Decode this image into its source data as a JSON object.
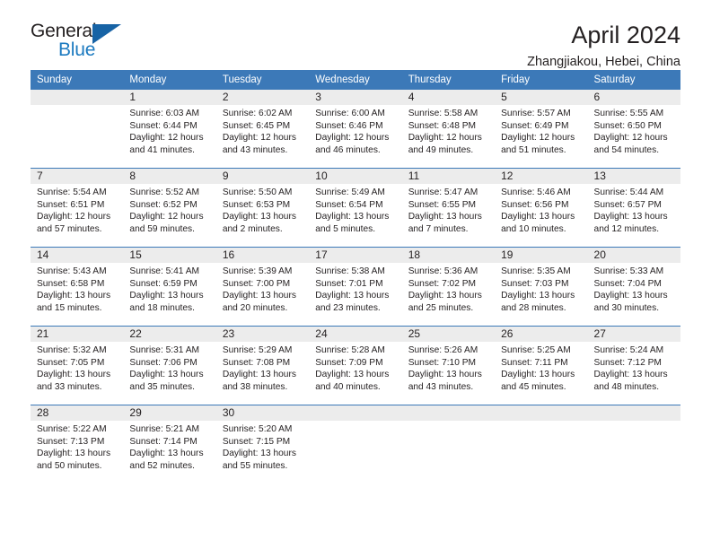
{
  "logo": {
    "primary_text": "General",
    "secondary_text": "Blue",
    "primary_color": "#231f20",
    "secondary_color": "#1c7ac0",
    "triangle_color": "#1763a5",
    "icon": "triangle-icon"
  },
  "header": {
    "title": "April 2024",
    "subtitle": "Zhangjiakou, Hebei, China"
  },
  "theme": {
    "header_row_bg": "#3c79b8",
    "header_row_text": "#ffffff",
    "day_number_bg": "#ececec",
    "grid_line": "#3c79b8",
    "body_text": "#231f20"
  },
  "calendar": {
    "weekday_headers": [
      "Sunday",
      "Monday",
      "Tuesday",
      "Wednesday",
      "Thursday",
      "Friday",
      "Saturday"
    ],
    "weeks": [
      [
        {
          "day": "",
          "sunrise": "",
          "sunset": "",
          "daylight_line1": "",
          "daylight_line2": ""
        },
        {
          "day": "1",
          "sunrise": "Sunrise: 6:03 AM",
          "sunset": "Sunset: 6:44 PM",
          "daylight_line1": "Daylight: 12 hours",
          "daylight_line2": "and 41 minutes."
        },
        {
          "day": "2",
          "sunrise": "Sunrise: 6:02 AM",
          "sunset": "Sunset: 6:45 PM",
          "daylight_line1": "Daylight: 12 hours",
          "daylight_line2": "and 43 minutes."
        },
        {
          "day": "3",
          "sunrise": "Sunrise: 6:00 AM",
          "sunset": "Sunset: 6:46 PM",
          "daylight_line1": "Daylight: 12 hours",
          "daylight_line2": "and 46 minutes."
        },
        {
          "day": "4",
          "sunrise": "Sunrise: 5:58 AM",
          "sunset": "Sunset: 6:48 PM",
          "daylight_line1": "Daylight: 12 hours",
          "daylight_line2": "and 49 minutes."
        },
        {
          "day": "5",
          "sunrise": "Sunrise: 5:57 AM",
          "sunset": "Sunset: 6:49 PM",
          "daylight_line1": "Daylight: 12 hours",
          "daylight_line2": "and 51 minutes."
        },
        {
          "day": "6",
          "sunrise": "Sunrise: 5:55 AM",
          "sunset": "Sunset: 6:50 PM",
          "daylight_line1": "Daylight: 12 hours",
          "daylight_line2": "and 54 minutes."
        }
      ],
      [
        {
          "day": "7",
          "sunrise": "Sunrise: 5:54 AM",
          "sunset": "Sunset: 6:51 PM",
          "daylight_line1": "Daylight: 12 hours",
          "daylight_line2": "and 57 minutes."
        },
        {
          "day": "8",
          "sunrise": "Sunrise: 5:52 AM",
          "sunset": "Sunset: 6:52 PM",
          "daylight_line1": "Daylight: 12 hours",
          "daylight_line2": "and 59 minutes."
        },
        {
          "day": "9",
          "sunrise": "Sunrise: 5:50 AM",
          "sunset": "Sunset: 6:53 PM",
          "daylight_line1": "Daylight: 13 hours",
          "daylight_line2": "and 2 minutes."
        },
        {
          "day": "10",
          "sunrise": "Sunrise: 5:49 AM",
          "sunset": "Sunset: 6:54 PM",
          "daylight_line1": "Daylight: 13 hours",
          "daylight_line2": "and 5 minutes."
        },
        {
          "day": "11",
          "sunrise": "Sunrise: 5:47 AM",
          "sunset": "Sunset: 6:55 PM",
          "daylight_line1": "Daylight: 13 hours",
          "daylight_line2": "and 7 minutes."
        },
        {
          "day": "12",
          "sunrise": "Sunrise: 5:46 AM",
          "sunset": "Sunset: 6:56 PM",
          "daylight_line1": "Daylight: 13 hours",
          "daylight_line2": "and 10 minutes."
        },
        {
          "day": "13",
          "sunrise": "Sunrise: 5:44 AM",
          "sunset": "Sunset: 6:57 PM",
          "daylight_line1": "Daylight: 13 hours",
          "daylight_line2": "and 12 minutes."
        }
      ],
      [
        {
          "day": "14",
          "sunrise": "Sunrise: 5:43 AM",
          "sunset": "Sunset: 6:58 PM",
          "daylight_line1": "Daylight: 13 hours",
          "daylight_line2": "and 15 minutes."
        },
        {
          "day": "15",
          "sunrise": "Sunrise: 5:41 AM",
          "sunset": "Sunset: 6:59 PM",
          "daylight_line1": "Daylight: 13 hours",
          "daylight_line2": "and 18 minutes."
        },
        {
          "day": "16",
          "sunrise": "Sunrise: 5:39 AM",
          "sunset": "Sunset: 7:00 PM",
          "daylight_line1": "Daylight: 13 hours",
          "daylight_line2": "and 20 minutes."
        },
        {
          "day": "17",
          "sunrise": "Sunrise: 5:38 AM",
          "sunset": "Sunset: 7:01 PM",
          "daylight_line1": "Daylight: 13 hours",
          "daylight_line2": "and 23 minutes."
        },
        {
          "day": "18",
          "sunrise": "Sunrise: 5:36 AM",
          "sunset": "Sunset: 7:02 PM",
          "daylight_line1": "Daylight: 13 hours",
          "daylight_line2": "and 25 minutes."
        },
        {
          "day": "19",
          "sunrise": "Sunrise: 5:35 AM",
          "sunset": "Sunset: 7:03 PM",
          "daylight_line1": "Daylight: 13 hours",
          "daylight_line2": "and 28 minutes."
        },
        {
          "day": "20",
          "sunrise": "Sunrise: 5:33 AM",
          "sunset": "Sunset: 7:04 PM",
          "daylight_line1": "Daylight: 13 hours",
          "daylight_line2": "and 30 minutes."
        }
      ],
      [
        {
          "day": "21",
          "sunrise": "Sunrise: 5:32 AM",
          "sunset": "Sunset: 7:05 PM",
          "daylight_line1": "Daylight: 13 hours",
          "daylight_line2": "and 33 minutes."
        },
        {
          "day": "22",
          "sunrise": "Sunrise: 5:31 AM",
          "sunset": "Sunset: 7:06 PM",
          "daylight_line1": "Daylight: 13 hours",
          "daylight_line2": "and 35 minutes."
        },
        {
          "day": "23",
          "sunrise": "Sunrise: 5:29 AM",
          "sunset": "Sunset: 7:08 PM",
          "daylight_line1": "Daylight: 13 hours",
          "daylight_line2": "and 38 minutes."
        },
        {
          "day": "24",
          "sunrise": "Sunrise: 5:28 AM",
          "sunset": "Sunset: 7:09 PM",
          "daylight_line1": "Daylight: 13 hours",
          "daylight_line2": "and 40 minutes."
        },
        {
          "day": "25",
          "sunrise": "Sunrise: 5:26 AM",
          "sunset": "Sunset: 7:10 PM",
          "daylight_line1": "Daylight: 13 hours",
          "daylight_line2": "and 43 minutes."
        },
        {
          "day": "26",
          "sunrise": "Sunrise: 5:25 AM",
          "sunset": "Sunset: 7:11 PM",
          "daylight_line1": "Daylight: 13 hours",
          "daylight_line2": "and 45 minutes."
        },
        {
          "day": "27",
          "sunrise": "Sunrise: 5:24 AM",
          "sunset": "Sunset: 7:12 PM",
          "daylight_line1": "Daylight: 13 hours",
          "daylight_line2": "and 48 minutes."
        }
      ],
      [
        {
          "day": "28",
          "sunrise": "Sunrise: 5:22 AM",
          "sunset": "Sunset: 7:13 PM",
          "daylight_line1": "Daylight: 13 hours",
          "daylight_line2": "and 50 minutes."
        },
        {
          "day": "29",
          "sunrise": "Sunrise: 5:21 AM",
          "sunset": "Sunset: 7:14 PM",
          "daylight_line1": "Daylight: 13 hours",
          "daylight_line2": "and 52 minutes."
        },
        {
          "day": "30",
          "sunrise": "Sunrise: 5:20 AM",
          "sunset": "Sunset: 7:15 PM",
          "daylight_line1": "Daylight: 13 hours",
          "daylight_line2": "and 55 minutes."
        },
        {
          "day": "",
          "sunrise": "",
          "sunset": "",
          "daylight_line1": "",
          "daylight_line2": ""
        },
        {
          "day": "",
          "sunrise": "",
          "sunset": "",
          "daylight_line1": "",
          "daylight_line2": ""
        },
        {
          "day": "",
          "sunrise": "",
          "sunset": "",
          "daylight_line1": "",
          "daylight_line2": ""
        },
        {
          "day": "",
          "sunrise": "",
          "sunset": "",
          "daylight_line1": "",
          "daylight_line2": ""
        }
      ]
    ]
  }
}
